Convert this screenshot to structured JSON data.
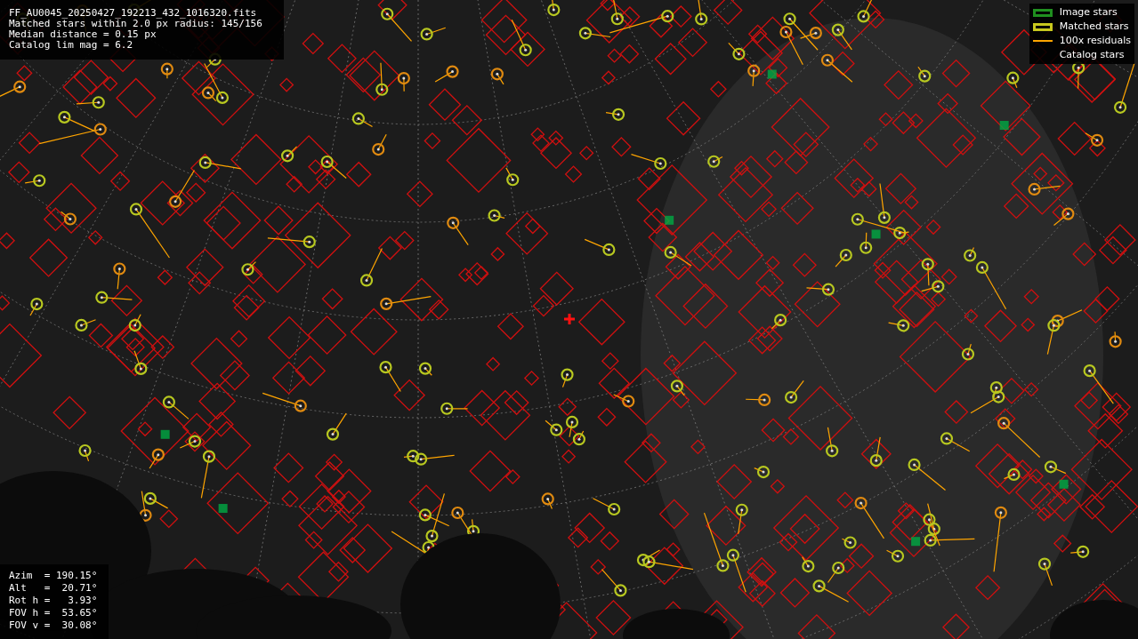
{
  "info": [
    "FF_AU0045_20250427_192213_432_1016320.fits",
    "Matched stars within 2.0 px radius: 145/156",
    "Median distance = 0.15 px",
    "Catalog lim mag = 6.2"
  ],
  "legend": [
    {
      "kind": "image",
      "label": "Image stars",
      "color": "#1f8f1f"
    },
    {
      "kind": "matched",
      "label": "Matched stars",
      "color": "#c8c81e"
    },
    {
      "kind": "residual",
      "label": "100x residuals",
      "color": "#ffa500"
    },
    {
      "kind": "catalog",
      "label": "Catalog stars"
    }
  ],
  "pointing": [
    "Azim  = 190.15°",
    "Alt   =  20.71°",
    "Rot h =   3.93°",
    "FOV h =  53.65°",
    "FOV v =  30.08°"
  ]
}
